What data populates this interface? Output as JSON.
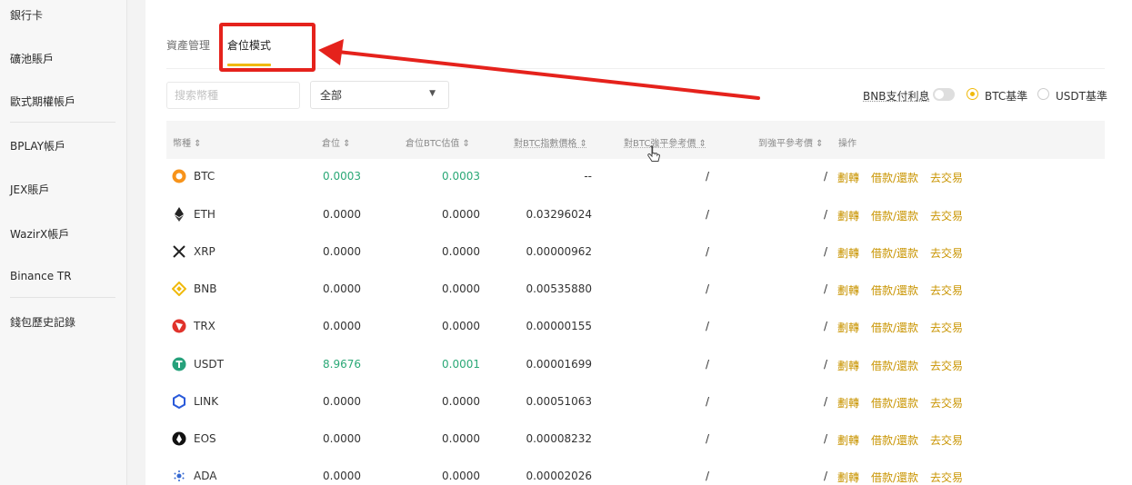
{
  "sidebar": {
    "items": [
      {
        "label": "銀行卡"
      },
      {
        "label": "礦池賬戶"
      },
      {
        "label": "歐式期權帳戶"
      },
      {
        "label": "BPLAY帳戶"
      },
      {
        "label": "JEX賬戶"
      },
      {
        "label": "WazirX帳戶"
      },
      {
        "label": "Binance TR"
      },
      {
        "label": "錢包歷史記錄"
      }
    ]
  },
  "tabs": [
    {
      "label": "資產管理",
      "active": false
    },
    {
      "label": "倉位模式",
      "active": true
    }
  ],
  "filters": {
    "search_placeholder": "搜索幣種",
    "select_value": "全部",
    "bnb_interest_label": "BNB支付利息",
    "radio_btc_label": "BTC基準",
    "radio_usdt_label": "USDT基準"
  },
  "table": {
    "headers": [
      "幣種",
      "倉位",
      "倉位BTC估值",
      "對BTC指數價格",
      "對BTC強平參考價",
      "到強平參考價",
      "操作"
    ],
    "actions": [
      "劃轉",
      "借款/還款",
      "去交易"
    ],
    "rows": [
      {
        "coin": "BTC",
        "position": "0.0003",
        "btc_value": "0.0003",
        "index_price": "--",
        "liq_ref": "/",
        "to_liq": "/",
        "green": true,
        "icon": "btc-icon"
      },
      {
        "coin": "ETH",
        "position": "0.0000",
        "btc_value": "0.0000",
        "index_price": "0.03296024",
        "liq_ref": "/",
        "to_liq": "/",
        "green": false,
        "icon": "eth-icon"
      },
      {
        "coin": "XRP",
        "position": "0.0000",
        "btc_value": "0.0000",
        "index_price": "0.00000962",
        "liq_ref": "/",
        "to_liq": "/",
        "green": false,
        "icon": "xrp-icon"
      },
      {
        "coin": "BNB",
        "position": "0.0000",
        "btc_value": "0.0000",
        "index_price": "0.00535880",
        "liq_ref": "/",
        "to_liq": "/",
        "green": false,
        "icon": "bnb-icon"
      },
      {
        "coin": "TRX",
        "position": "0.0000",
        "btc_value": "0.0000",
        "index_price": "0.00000155",
        "liq_ref": "/",
        "to_liq": "/",
        "green": false,
        "icon": "trx-icon"
      },
      {
        "coin": "USDT",
        "position": "8.9676",
        "btc_value": "0.0001",
        "index_price": "0.00001699",
        "liq_ref": "/",
        "to_liq": "/",
        "green": true,
        "icon": "usdt-icon"
      },
      {
        "coin": "LINK",
        "position": "0.0000",
        "btc_value": "0.0000",
        "index_price": "0.00051063",
        "liq_ref": "/",
        "to_liq": "/",
        "green": false,
        "icon": "link-icon"
      },
      {
        "coin": "EOS",
        "position": "0.0000",
        "btc_value": "0.0000",
        "index_price": "0.00008232",
        "liq_ref": "/",
        "to_liq": "/",
        "green": false,
        "icon": "eos-icon"
      },
      {
        "coin": "ADA",
        "position": "0.0000",
        "btc_value": "0.0000",
        "index_price": "0.00002026",
        "liq_ref": "/",
        "to_liq": "/",
        "green": false,
        "icon": "ada-icon"
      }
    ]
  },
  "colors": {
    "accent": "#f0b90b",
    "action": "#c99400",
    "positive": "#2aa876",
    "annotation": "#e5221c"
  }
}
